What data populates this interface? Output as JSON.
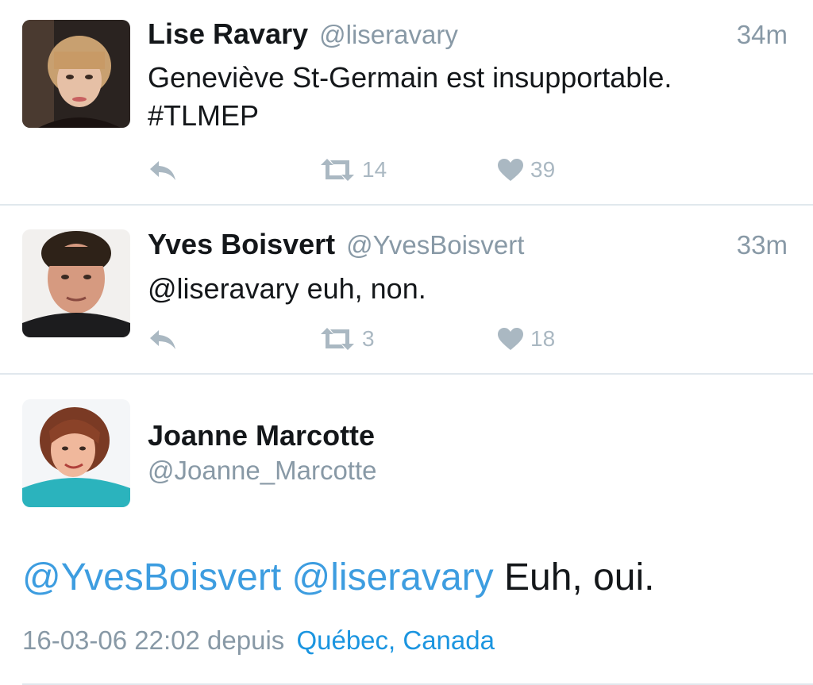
{
  "tweets": [
    {
      "display_name": "Lise Ravary",
      "handle": "@liseravary",
      "timestamp": "34m",
      "text_lines": [
        "Geneviève St-Germain est insupportable.",
        "#TLMEP"
      ],
      "retweets": "14",
      "likes": "39"
    },
    {
      "display_name": "Yves Boisvert",
      "handle": "@YvesBoisvert",
      "timestamp": "33m",
      "text_lines": [
        "@liseravary euh, non."
      ],
      "retweets": "3",
      "likes": "18"
    }
  ],
  "focused_tweet": {
    "display_name": "Joanne Marcotte",
    "handle": "@Joanne_Marcotte",
    "mention_1": "@YvesBoisvert",
    "mention_2": "@liseravary",
    "text": "Euh, oui.",
    "datetime": "16-03-06 22:02",
    "via": "depuis",
    "location": "Québec, Canada"
  },
  "icons": {
    "reply": "reply-icon",
    "retweet": "retweet-icon",
    "like": "heart-icon"
  },
  "colors": {
    "mention": "#3d9de0",
    "location_link": "#1b95e0",
    "muted_text": "#8899a6",
    "action_icon": "#aab8c2",
    "divider": "#e1e8ed"
  }
}
